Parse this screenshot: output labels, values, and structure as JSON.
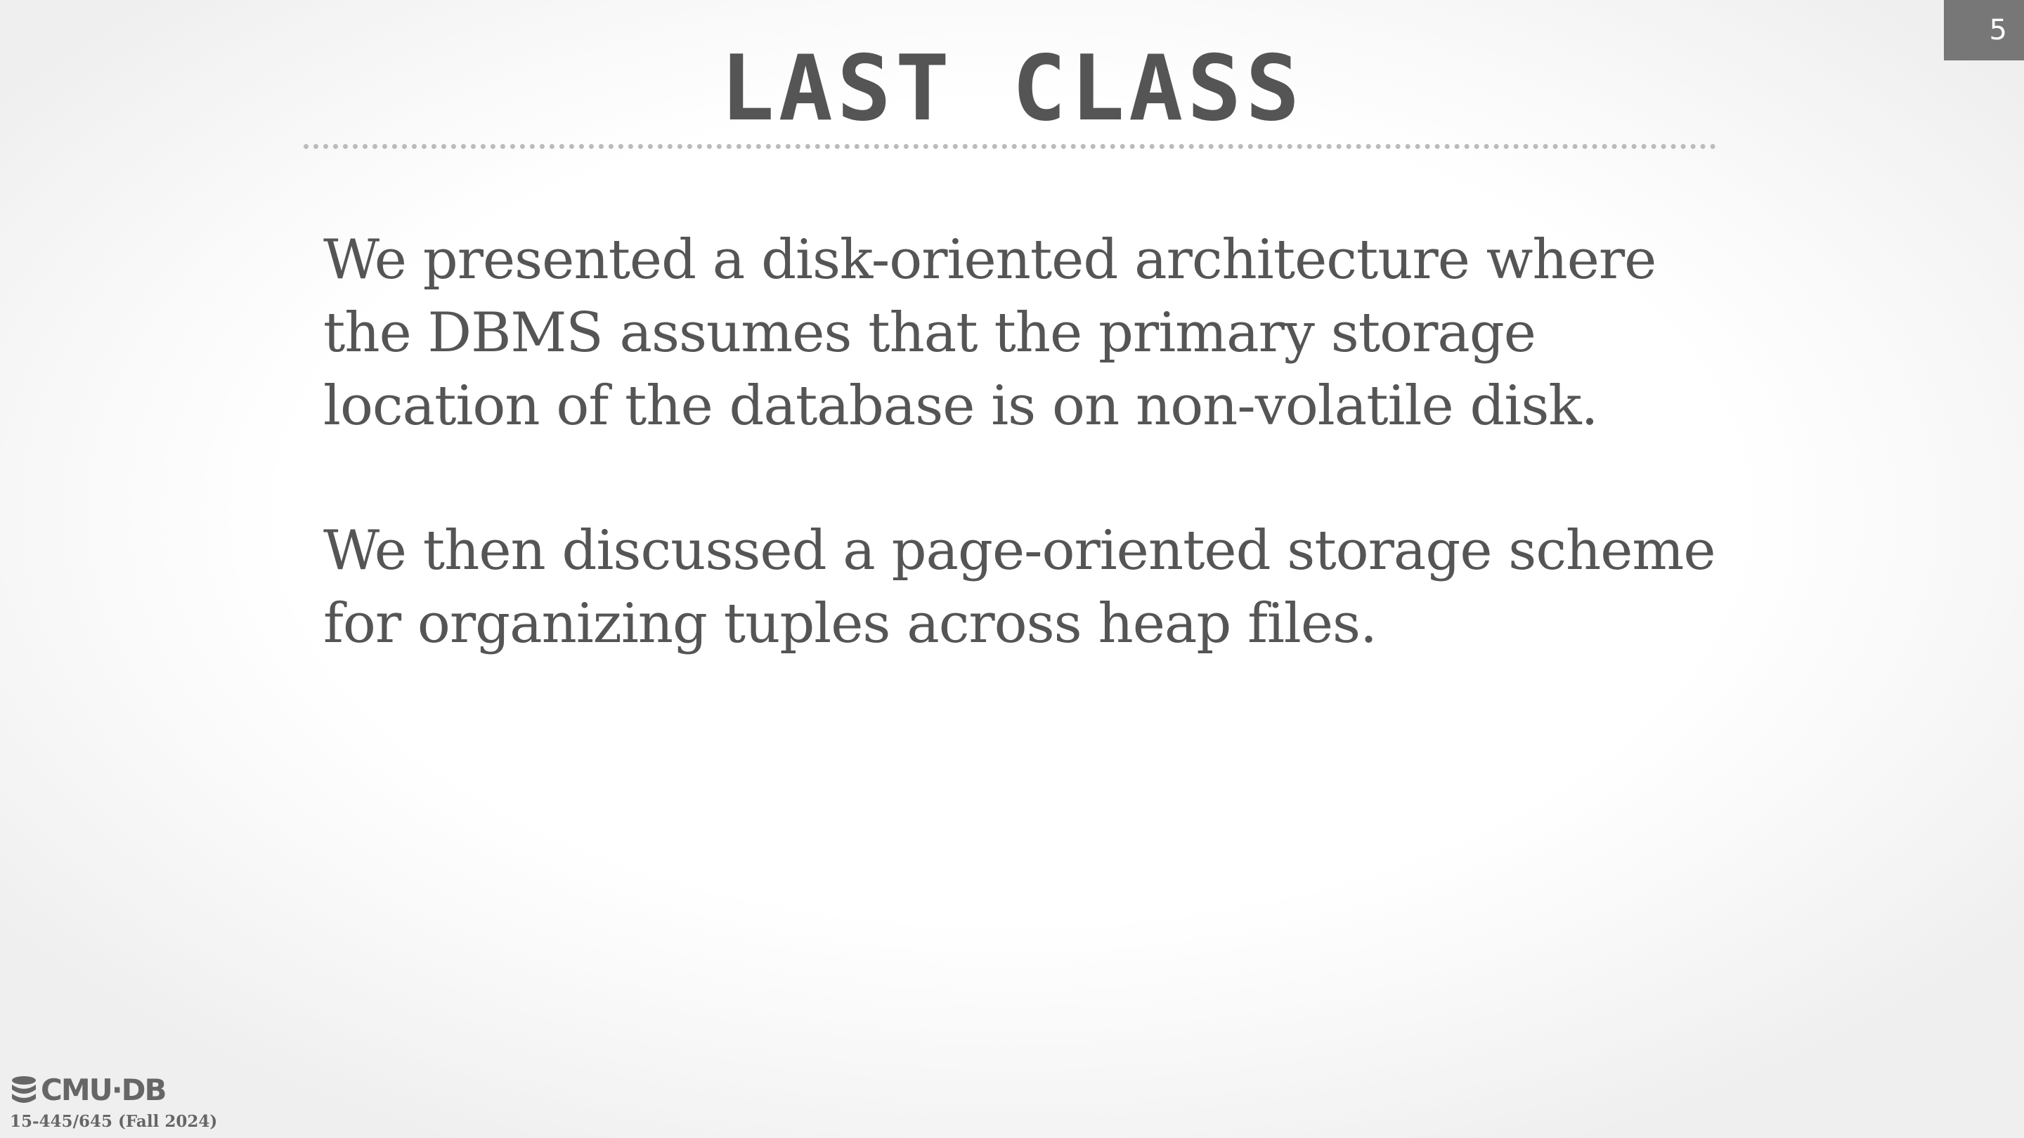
{
  "slide": {
    "title": "LAST CLASS",
    "page_number": "5",
    "paragraphs": [
      "We presented a disk-oriented architecture where the DBMS assumes that the primary storage location of the database is on non-volatile disk.",
      "We then discussed a page-oriented storage scheme for organizing tuples across heap files."
    ]
  },
  "footer": {
    "logo_text": "CMU·DB",
    "logo_icon": "database-icon",
    "course": "15-445/645 (Fall 2024)"
  }
}
